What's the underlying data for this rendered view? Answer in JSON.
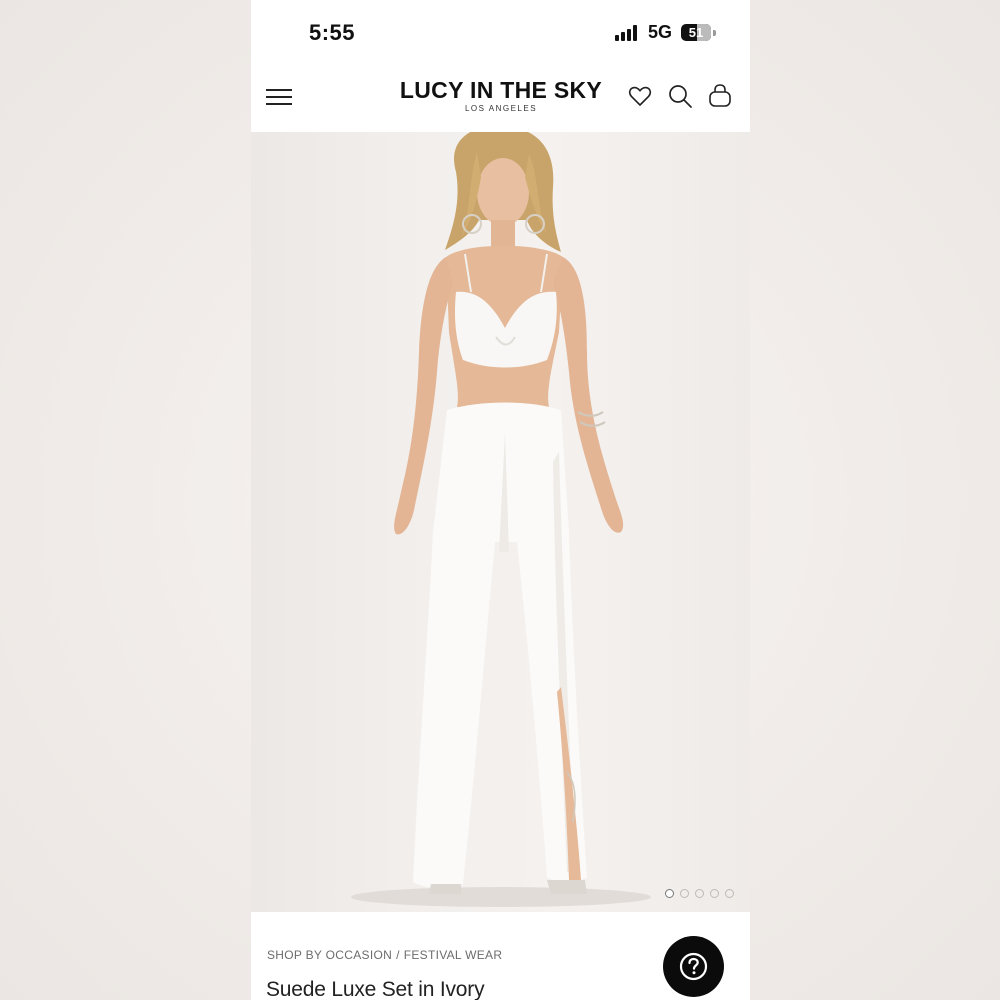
{
  "status_bar": {
    "time": "5:55",
    "network": "5G",
    "battery": "51"
  },
  "header": {
    "brand_name": "LUCY IN THE SKY",
    "brand_subtitle": "LOS ANGELES",
    "icons": [
      "menu-icon",
      "heart-icon",
      "search-icon",
      "bag-icon"
    ]
  },
  "gallery": {
    "image_count": 5,
    "active_index": 0
  },
  "breadcrumb": {
    "items": [
      "SHOP BY OCCASION",
      "FESTIVAL WEAR"
    ],
    "separator": "/"
  },
  "product": {
    "title": "Suede Luxe Set in Ivory"
  },
  "help": {
    "icon": "question-icon"
  },
  "colors": {
    "background": "#f4f1ee",
    "text": "#111111",
    "help_button": "#0b0b0b"
  }
}
